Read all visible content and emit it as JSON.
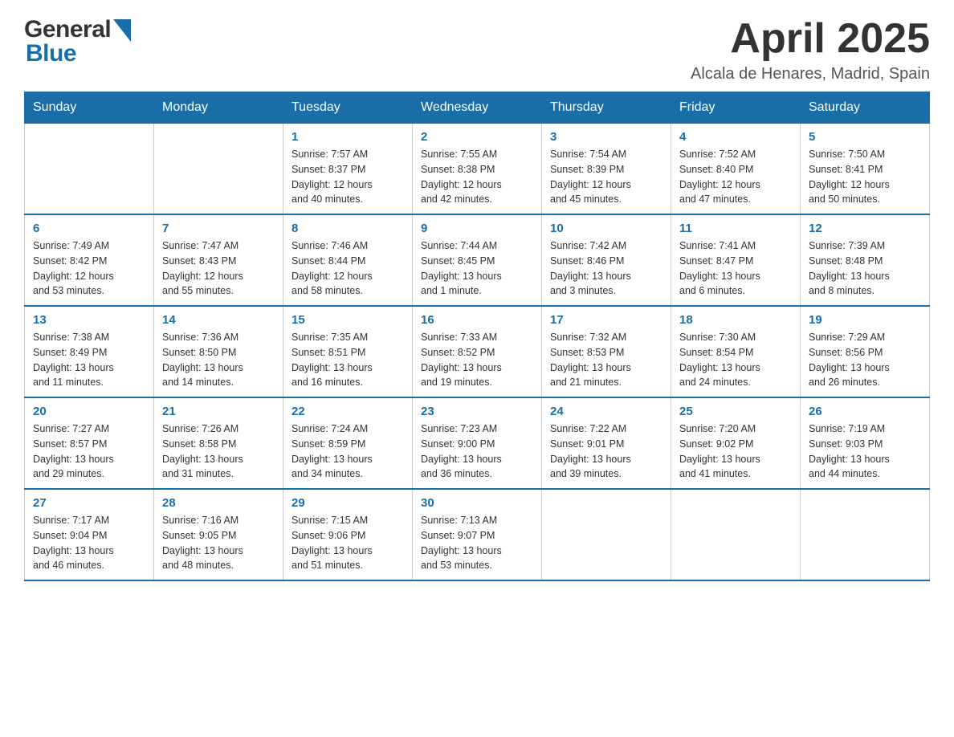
{
  "logo": {
    "general": "General",
    "blue": "Blue"
  },
  "header": {
    "title": "April 2025",
    "location": "Alcala de Henares, Madrid, Spain"
  },
  "weekdays": [
    "Sunday",
    "Monday",
    "Tuesday",
    "Wednesday",
    "Thursday",
    "Friday",
    "Saturday"
  ],
  "weeks": [
    [
      {
        "day": "",
        "info": ""
      },
      {
        "day": "",
        "info": ""
      },
      {
        "day": "1",
        "info": "Sunrise: 7:57 AM\nSunset: 8:37 PM\nDaylight: 12 hours\nand 40 minutes."
      },
      {
        "day": "2",
        "info": "Sunrise: 7:55 AM\nSunset: 8:38 PM\nDaylight: 12 hours\nand 42 minutes."
      },
      {
        "day": "3",
        "info": "Sunrise: 7:54 AM\nSunset: 8:39 PM\nDaylight: 12 hours\nand 45 minutes."
      },
      {
        "day": "4",
        "info": "Sunrise: 7:52 AM\nSunset: 8:40 PM\nDaylight: 12 hours\nand 47 minutes."
      },
      {
        "day": "5",
        "info": "Sunrise: 7:50 AM\nSunset: 8:41 PM\nDaylight: 12 hours\nand 50 minutes."
      }
    ],
    [
      {
        "day": "6",
        "info": "Sunrise: 7:49 AM\nSunset: 8:42 PM\nDaylight: 12 hours\nand 53 minutes."
      },
      {
        "day": "7",
        "info": "Sunrise: 7:47 AM\nSunset: 8:43 PM\nDaylight: 12 hours\nand 55 minutes."
      },
      {
        "day": "8",
        "info": "Sunrise: 7:46 AM\nSunset: 8:44 PM\nDaylight: 12 hours\nand 58 minutes."
      },
      {
        "day": "9",
        "info": "Sunrise: 7:44 AM\nSunset: 8:45 PM\nDaylight: 13 hours\nand 1 minute."
      },
      {
        "day": "10",
        "info": "Sunrise: 7:42 AM\nSunset: 8:46 PM\nDaylight: 13 hours\nand 3 minutes."
      },
      {
        "day": "11",
        "info": "Sunrise: 7:41 AM\nSunset: 8:47 PM\nDaylight: 13 hours\nand 6 minutes."
      },
      {
        "day": "12",
        "info": "Sunrise: 7:39 AM\nSunset: 8:48 PM\nDaylight: 13 hours\nand 8 minutes."
      }
    ],
    [
      {
        "day": "13",
        "info": "Sunrise: 7:38 AM\nSunset: 8:49 PM\nDaylight: 13 hours\nand 11 minutes."
      },
      {
        "day": "14",
        "info": "Sunrise: 7:36 AM\nSunset: 8:50 PM\nDaylight: 13 hours\nand 14 minutes."
      },
      {
        "day": "15",
        "info": "Sunrise: 7:35 AM\nSunset: 8:51 PM\nDaylight: 13 hours\nand 16 minutes."
      },
      {
        "day": "16",
        "info": "Sunrise: 7:33 AM\nSunset: 8:52 PM\nDaylight: 13 hours\nand 19 minutes."
      },
      {
        "day": "17",
        "info": "Sunrise: 7:32 AM\nSunset: 8:53 PM\nDaylight: 13 hours\nand 21 minutes."
      },
      {
        "day": "18",
        "info": "Sunrise: 7:30 AM\nSunset: 8:54 PM\nDaylight: 13 hours\nand 24 minutes."
      },
      {
        "day": "19",
        "info": "Sunrise: 7:29 AM\nSunset: 8:56 PM\nDaylight: 13 hours\nand 26 minutes."
      }
    ],
    [
      {
        "day": "20",
        "info": "Sunrise: 7:27 AM\nSunset: 8:57 PM\nDaylight: 13 hours\nand 29 minutes."
      },
      {
        "day": "21",
        "info": "Sunrise: 7:26 AM\nSunset: 8:58 PM\nDaylight: 13 hours\nand 31 minutes."
      },
      {
        "day": "22",
        "info": "Sunrise: 7:24 AM\nSunset: 8:59 PM\nDaylight: 13 hours\nand 34 minutes."
      },
      {
        "day": "23",
        "info": "Sunrise: 7:23 AM\nSunset: 9:00 PM\nDaylight: 13 hours\nand 36 minutes."
      },
      {
        "day": "24",
        "info": "Sunrise: 7:22 AM\nSunset: 9:01 PM\nDaylight: 13 hours\nand 39 minutes."
      },
      {
        "day": "25",
        "info": "Sunrise: 7:20 AM\nSunset: 9:02 PM\nDaylight: 13 hours\nand 41 minutes."
      },
      {
        "day": "26",
        "info": "Sunrise: 7:19 AM\nSunset: 9:03 PM\nDaylight: 13 hours\nand 44 minutes."
      }
    ],
    [
      {
        "day": "27",
        "info": "Sunrise: 7:17 AM\nSunset: 9:04 PM\nDaylight: 13 hours\nand 46 minutes."
      },
      {
        "day": "28",
        "info": "Sunrise: 7:16 AM\nSunset: 9:05 PM\nDaylight: 13 hours\nand 48 minutes."
      },
      {
        "day": "29",
        "info": "Sunrise: 7:15 AM\nSunset: 9:06 PM\nDaylight: 13 hours\nand 51 minutes."
      },
      {
        "day": "30",
        "info": "Sunrise: 7:13 AM\nSunset: 9:07 PM\nDaylight: 13 hours\nand 53 minutes."
      },
      {
        "day": "",
        "info": ""
      },
      {
        "day": "",
        "info": ""
      },
      {
        "day": "",
        "info": ""
      }
    ]
  ]
}
